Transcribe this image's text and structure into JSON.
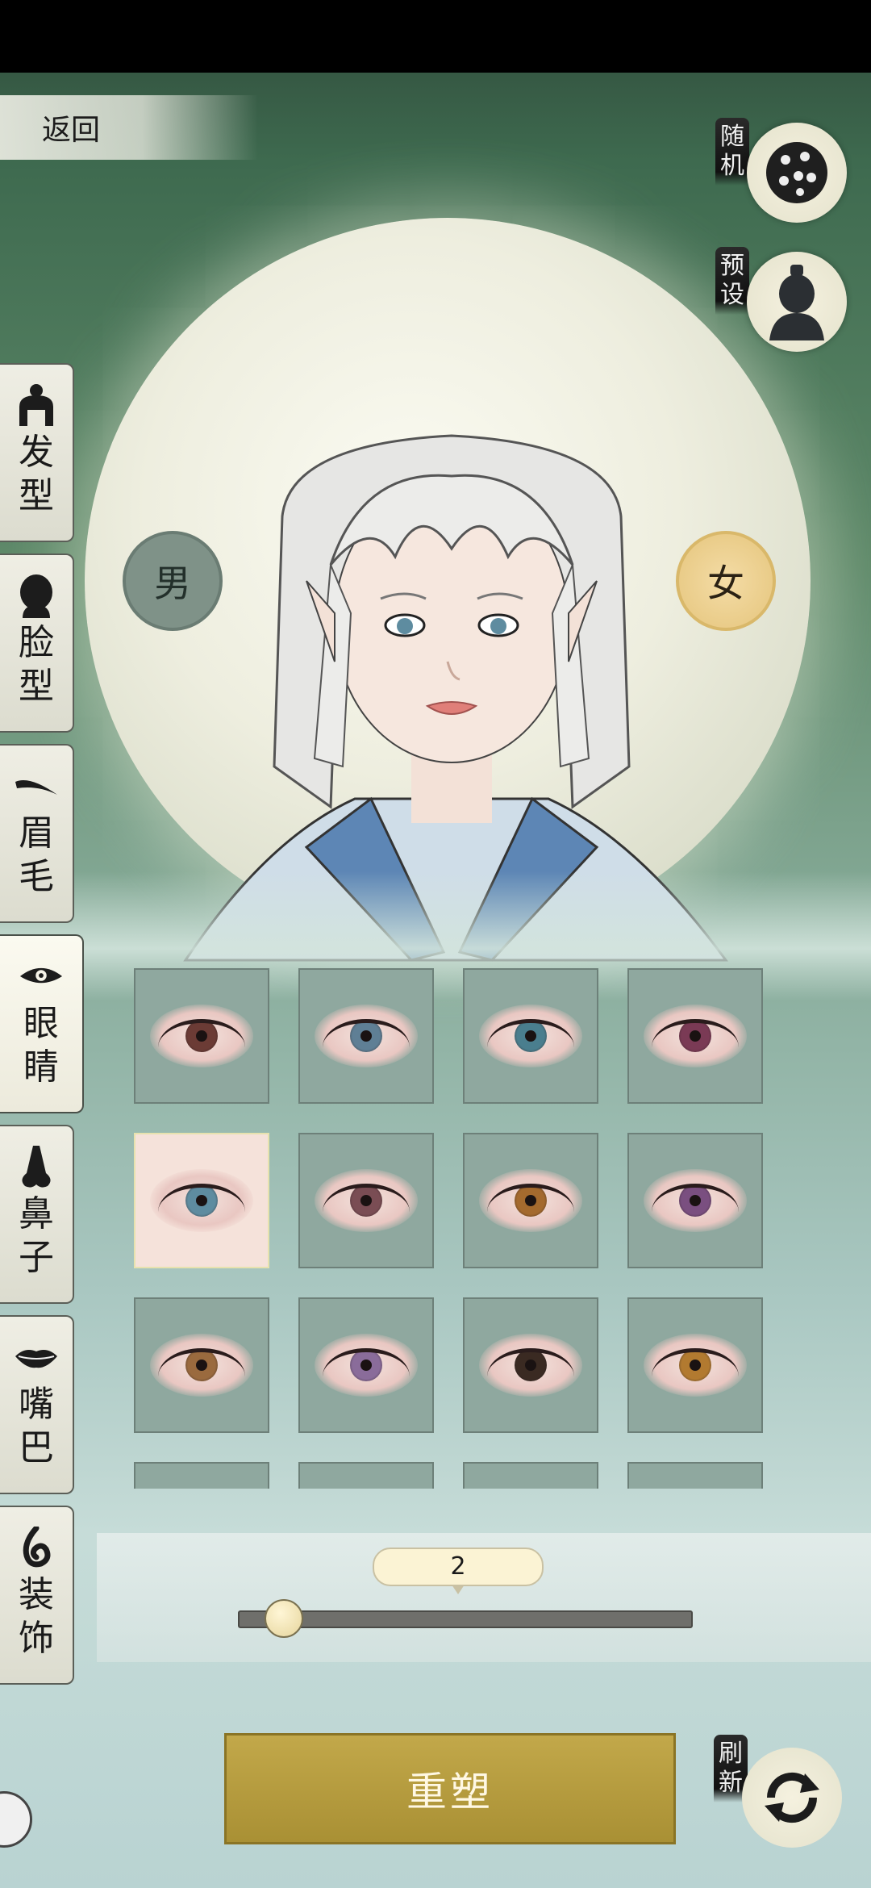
{
  "header": {
    "back_label": "返回"
  },
  "right_controls": {
    "random_label": "随机",
    "preset_label": "预设",
    "refresh_label": "刷新"
  },
  "gender": {
    "male": "男",
    "female": "女",
    "selected": "女"
  },
  "tabs": [
    {
      "label": "发型",
      "icon": "hair-bun-icon"
    },
    {
      "label": "脸型",
      "icon": "face-silhouette-icon"
    },
    {
      "label": "眉毛",
      "icon": "eyebrow-icon"
    },
    {
      "label": "眼睛",
      "icon": "eye-icon",
      "active": true
    },
    {
      "label": "鼻子",
      "icon": "nose-icon"
    },
    {
      "label": "嘴巴",
      "icon": "lips-icon"
    },
    {
      "label": "装饰",
      "icon": "ornament-icon"
    }
  ],
  "eye_options": {
    "selected_index": 4,
    "iris_colors": [
      "#6b3b35",
      "#5f7f95",
      "#4a7e8e",
      "#7a3a55",
      "#5e8ca0",
      "#7a4d54",
      "#a46a2e",
      "#7a4f80",
      "#9a6a3e",
      "#8a6c9a",
      "#3a2a22",
      "#b27a30"
    ]
  },
  "slider": {
    "value": "2",
    "fraction": 0.07
  },
  "actions": {
    "reset_label": "重塑"
  },
  "colors": {
    "accent_gold": "#b89c3e",
    "panel": "#8fa89f"
  }
}
